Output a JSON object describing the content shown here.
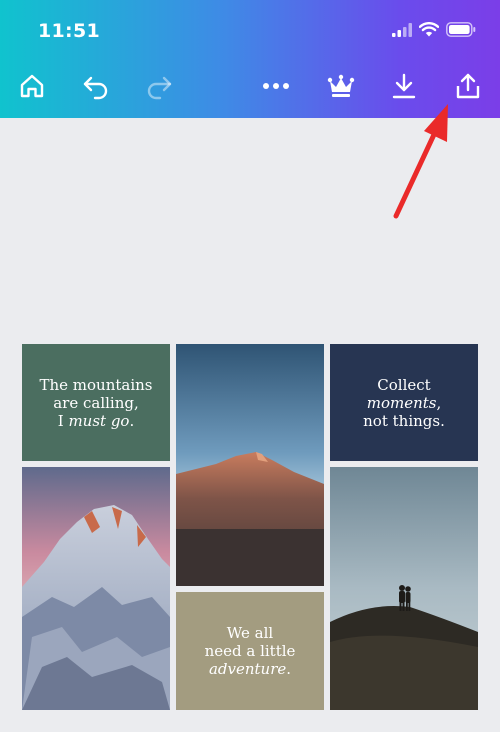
{
  "status_bar": {
    "time": "11:51"
  },
  "toolbar": {
    "home_icon": "home-icon",
    "undo_icon": "undo-icon",
    "redo_icon": "redo-icon",
    "more_icon": "more-icon",
    "premium_icon": "crown-icon",
    "download_icon": "download-icon",
    "share_icon": "share-icon"
  },
  "design": {
    "quote1": {
      "line1": "The mountains",
      "line2": "are calling,",
      "line3_prefix": "I ",
      "line3_italic": "must go",
      "line3_suffix": "."
    },
    "quote2": {
      "line1": "Collect",
      "line2_italic": "moments",
      "line2_suffix": ",",
      "line3": "not things."
    },
    "quote3": {
      "line1": "We all",
      "line2": "need a little",
      "line3_italic": "adventure",
      "line3_suffix": "."
    }
  },
  "colors": {
    "green_tile": "#4b6e60",
    "navy_tile": "#273552",
    "khaki_tile": "#a39c80",
    "annotation_arrow": "#ea2a2a"
  }
}
